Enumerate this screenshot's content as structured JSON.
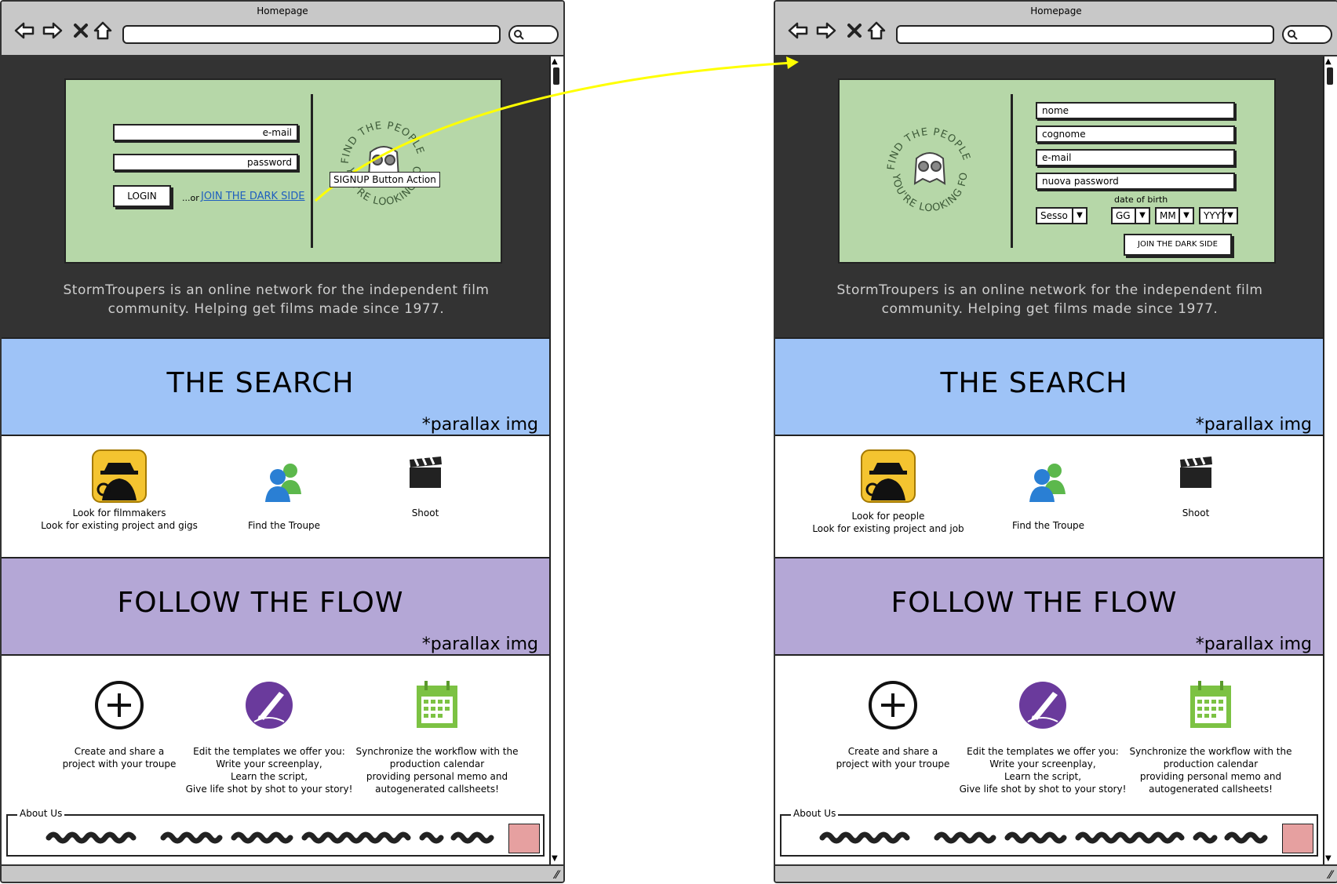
{
  "browser": {
    "title": "Homepage"
  },
  "left": {
    "login": {
      "email_placeholder": "e-mail",
      "password_placeholder": "password",
      "login_label": "LOGIN",
      "or_text": "...or",
      "signup_link": "JOIN THE DARK SIDE"
    },
    "annotation": {
      "tooltip": "SIGNUP Button Action"
    },
    "features_one": [
      {
        "line1": "Look for filmmakers",
        "line2": "Look for existing project and gigs"
      },
      {
        "line1": "Find the Troupe",
        "line2": ""
      },
      {
        "line1": "Shoot",
        "line2": ""
      }
    ]
  },
  "right": {
    "signup": {
      "nome": "nome",
      "cognome": "cognome",
      "email": "e-mail",
      "password": "nuova password",
      "date_label": "date of birth",
      "sesso": "Sesso",
      "gg": "GG",
      "mm": "MM",
      "yyyy": "YYYY",
      "submit": "JOIN THE DARK SIDE"
    },
    "features_one": [
      {
        "line1": "Look for people",
        "line2": "Look for existing project and job"
      },
      {
        "line1": "Find the Troupe",
        "line2": ""
      },
      {
        "line1": "Shoot",
        "line2": ""
      }
    ]
  },
  "shared": {
    "logo_text_top": "FIND THE PEOPLE",
    "logo_text_bottom": "YOU'RE LOOKING FOR",
    "tagline_line1": "StormTroupers is an online network for the independent film",
    "tagline_line2": "community. Helping get films made since 1977.",
    "search_title": "THE SEARCH",
    "flow_title": "FOLLOW THE FLOW",
    "parallax": "*parallax img",
    "features_two": [
      {
        "lines": [
          "Create and share a",
          "project with your troupe"
        ]
      },
      {
        "lines": [
          "Edit the templates we offer you:",
          "Write your screenplay,",
          "Learn the script,",
          "Give life shot by shot to your story!"
        ]
      },
      {
        "lines": [
          "Synchronize the workflow with the",
          "production calendar",
          "providing personal memo and",
          "autogenerated callsheets!"
        ]
      }
    ],
    "about_label": "About Us"
  },
  "colors": {
    "hero_bg": "#333333",
    "card_green": "#b6d7a8",
    "band_blue": "#9ec3f7",
    "band_purple": "#b4a7d6",
    "link_blue": "#1f5fbf",
    "flow_arrow": "#ffff00"
  },
  "icons": [
    "back-arrow-icon",
    "forward-arrow-icon",
    "close-icon",
    "home-icon",
    "search-icon",
    "spy-icon",
    "users-icon",
    "clapperboard-icon",
    "plus-circle-icon",
    "pen-icon",
    "calendar-icon",
    "stormtrooper-icon"
  ]
}
